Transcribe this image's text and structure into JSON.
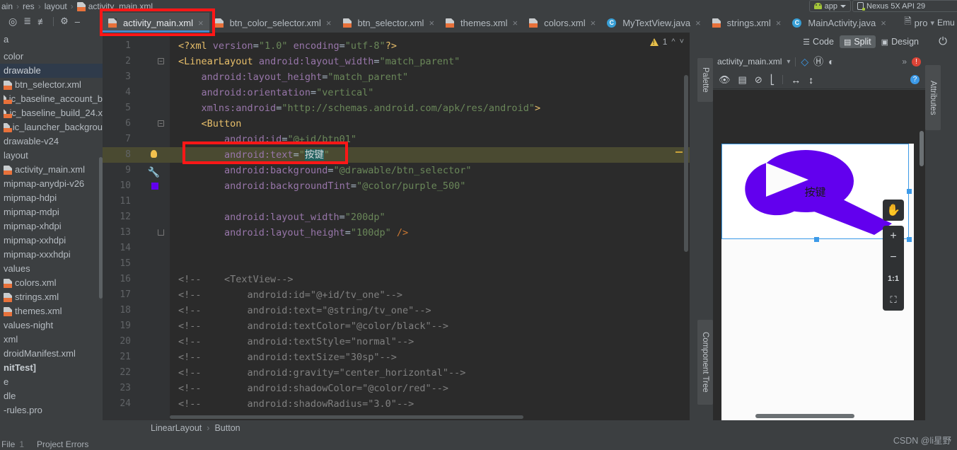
{
  "breadcrumb": {
    "items": [
      "ain",
      "res",
      "layout"
    ],
    "file": "activity_main.xml"
  },
  "run_config": {
    "app_label": "app",
    "device_label": "Nexus 5X API 29",
    "emulator_label": "Emu"
  },
  "project_panel": {
    "toolbar_icons": [
      "locate-icon",
      "expand-all-icon",
      "collapse-all-icon",
      "settings-icon",
      "hide-icon"
    ],
    "partial_top_label": "a",
    "items": [
      {
        "label": "color",
        "type": "folder",
        "selected": false
      },
      {
        "label": "drawable",
        "type": "folder",
        "selected": true
      },
      {
        "label": "btn_selector.xml",
        "type": "xml",
        "selected": false
      },
      {
        "label": "ic_baseline_account_b",
        "type": "xml",
        "selected": false
      },
      {
        "label": "ic_baseline_build_24.x",
        "type": "xml",
        "selected": false
      },
      {
        "label": "ic_launcher_backgrou",
        "type": "xml",
        "selected": false
      },
      {
        "label": "drawable-v24",
        "type": "folder",
        "selected": false
      },
      {
        "label": "layout",
        "type": "folder",
        "selected": false
      },
      {
        "label": "activity_main.xml",
        "type": "xml",
        "selected": false
      },
      {
        "label": "mipmap-anydpi-v26",
        "type": "folder",
        "selected": false
      },
      {
        "label": "mipmap-hdpi",
        "type": "folder",
        "selected": false
      },
      {
        "label": "mipmap-mdpi",
        "type": "folder",
        "selected": false
      },
      {
        "label": "mipmap-xhdpi",
        "type": "folder",
        "selected": false
      },
      {
        "label": "mipmap-xxhdpi",
        "type": "folder",
        "selected": false
      },
      {
        "label": "mipmap-xxxhdpi",
        "type": "folder",
        "selected": false
      },
      {
        "label": "values",
        "type": "folder",
        "selected": false
      },
      {
        "label": "colors.xml",
        "type": "xml",
        "selected": false
      },
      {
        "label": "strings.xml",
        "type": "xml",
        "selected": false
      },
      {
        "label": "themes.xml",
        "type": "xml",
        "selected": false
      },
      {
        "label": "values-night",
        "type": "folder",
        "selected": false
      },
      {
        "label": "xml",
        "type": "folder",
        "selected": false
      },
      {
        "label": "droidManifest.xml",
        "type": "folder",
        "selected": false
      },
      {
        "label": "nitTest]",
        "type": "bold",
        "selected": false
      },
      {
        "label": "e",
        "type": "folder",
        "selected": false
      },
      {
        "label": "dle",
        "type": "folder",
        "selected": false
      },
      {
        "label": "-rules.pro",
        "type": "folder",
        "selected": false
      }
    ]
  },
  "editor_tabs": [
    {
      "label": "activity_main.xml",
      "icon": "xml-file-icon",
      "active": true
    },
    {
      "label": "btn_color_selector.xml",
      "icon": "xml-file-icon",
      "active": false
    },
    {
      "label": "btn_selector.xml",
      "icon": "xml-file-icon",
      "active": false
    },
    {
      "label": "themes.xml",
      "icon": "xml-file-icon",
      "active": false
    },
    {
      "label": "colors.xml",
      "icon": "xml-file-icon",
      "active": false
    },
    {
      "label": "MyTextView.java",
      "icon": "java-class-icon",
      "active": false
    },
    {
      "label": "strings.xml",
      "icon": "xml-file-icon",
      "active": false
    },
    {
      "label": "MainActivity.java",
      "icon": "java-class-icon",
      "active": false
    },
    {
      "label": "pro",
      "icon": "props-file-icon",
      "active": false
    }
  ],
  "editor": {
    "warning_count": "1",
    "lines": [
      {
        "n": "1",
        "indent": 0,
        "segs": [
          {
            "t": "<?xml ",
            "c": "tag"
          },
          {
            "t": "version",
            "c": "ns"
          },
          {
            "t": "=",
            "c": "punct"
          },
          {
            "t": "\"1.0\"",
            "c": "val"
          },
          {
            "t": " ",
            "c": "punct"
          },
          {
            "t": "encoding",
            "c": "ns"
          },
          {
            "t": "=",
            "c": "punct"
          },
          {
            "t": "\"utf-8\"",
            "c": "val"
          },
          {
            "t": "?>",
            "c": "tag"
          }
        ]
      },
      {
        "n": "2",
        "fold": true,
        "segs": [
          {
            "t": "<LinearLayout",
            "c": "tag"
          },
          {
            "t": " ",
            "c": "punct"
          },
          {
            "t": "android:layout_width",
            "c": "ns"
          },
          {
            "t": "=",
            "c": "punct"
          },
          {
            "t": "\"match_parent\"",
            "c": "val"
          }
        ]
      },
      {
        "n": "3",
        "segs": [
          {
            "t": "    ",
            "c": "punct"
          },
          {
            "t": "android:layout_height",
            "c": "ns"
          },
          {
            "t": "=",
            "c": "punct"
          },
          {
            "t": "\"match_parent\"",
            "c": "val"
          }
        ]
      },
      {
        "n": "4",
        "segs": [
          {
            "t": "    ",
            "c": "punct"
          },
          {
            "t": "android:orientation",
            "c": "ns"
          },
          {
            "t": "=",
            "c": "punct"
          },
          {
            "t": "\"vertical\"",
            "c": "val"
          }
        ]
      },
      {
        "n": "5",
        "segs": [
          {
            "t": "    ",
            "c": "punct"
          },
          {
            "t": "xmlns:android",
            "c": "ns"
          },
          {
            "t": "=",
            "c": "punct"
          },
          {
            "t": "\"http://schemas.android.com/apk/res/android\"",
            "c": "val"
          },
          {
            "t": ">",
            "c": "tag"
          }
        ]
      },
      {
        "n": "6",
        "fold": true,
        "segs": [
          {
            "t": "    ",
            "c": "punct"
          },
          {
            "t": "<Button",
            "c": "tag"
          }
        ]
      },
      {
        "n": "7",
        "boxed": true,
        "segs": [
          {
            "t": "        ",
            "c": "punct"
          },
          {
            "t": "android:id",
            "c": "ns"
          },
          {
            "t": "=",
            "c": "punct"
          },
          {
            "t": "\"@+id/btn01\"",
            "c": "val"
          }
        ]
      },
      {
        "n": "8",
        "bulb": true,
        "highlight": true,
        "segs": [
          {
            "t": "        ",
            "c": "punct"
          },
          {
            "t": "android:text",
            "c": "ns"
          },
          {
            "t": "=",
            "c": "punct"
          },
          {
            "t": "\"",
            "c": "val"
          },
          {
            "t": "按键",
            "c": "sel"
          },
          {
            "t": "\"",
            "c": "val"
          }
        ]
      },
      {
        "n": "9",
        "wrench": true,
        "segs": [
          {
            "t": "        ",
            "c": "punct"
          },
          {
            "t": "android:background",
            "c": "ns"
          },
          {
            "t": "=",
            "c": "punct"
          },
          {
            "t": "\"@drawable/btn_selector\"",
            "c": "val"
          }
        ]
      },
      {
        "n": "10",
        "swatch": true,
        "segs": [
          {
            "t": "        ",
            "c": "punct"
          },
          {
            "t": "android:backgroundTint",
            "c": "ns"
          },
          {
            "t": "=",
            "c": "punct"
          },
          {
            "t": "\"@color/purple_500\"",
            "c": "val"
          }
        ]
      },
      {
        "n": "11",
        "segs": []
      },
      {
        "n": "12",
        "segs": [
          {
            "t": "        ",
            "c": "punct"
          },
          {
            "t": "android:layout_width",
            "c": "ns"
          },
          {
            "t": "=",
            "c": "punct"
          },
          {
            "t": "\"200dp\"",
            "c": "val"
          }
        ]
      },
      {
        "n": "13",
        "foldend": true,
        "segs": [
          {
            "t": "        ",
            "c": "punct"
          },
          {
            "t": "android:layout_height",
            "c": "ns"
          },
          {
            "t": "=",
            "c": "punct"
          },
          {
            "t": "\"100dp\" ",
            "c": "val"
          },
          {
            "t": "/>",
            "c": "brk"
          }
        ]
      },
      {
        "n": "14",
        "segs": []
      },
      {
        "n": "15",
        "segs": []
      },
      {
        "n": "16",
        "segs": [
          {
            "t": "<!--    <TextView-->",
            "c": "cmt"
          }
        ]
      },
      {
        "n": "17",
        "segs": [
          {
            "t": "<!--        android:id=\"@+id/tv_one\"-->",
            "c": "cmt"
          }
        ]
      },
      {
        "n": "18",
        "segs": [
          {
            "t": "<!--        android:text=\"@string/tv_one\"-->",
            "c": "cmt"
          }
        ]
      },
      {
        "n": "19",
        "segs": [
          {
            "t": "<!--        android:textColor=\"@color/black\"-->",
            "c": "cmt"
          }
        ]
      },
      {
        "n": "20",
        "segs": [
          {
            "t": "<!--        android:textStyle=\"normal\"-->",
            "c": "cmt"
          }
        ]
      },
      {
        "n": "21",
        "segs": [
          {
            "t": "<!--        android:textSize=\"30sp\"-->",
            "c": "cmt"
          }
        ]
      },
      {
        "n": "22",
        "segs": [
          {
            "t": "<!--        android:gravity=\"center_horizontal\"-->",
            "c": "cmt"
          }
        ]
      },
      {
        "n": "23",
        "segs": [
          {
            "t": "<!--        android:shadowColor=\"@color/red\"-->",
            "c": "cmt"
          }
        ]
      },
      {
        "n": "24",
        "segs": [
          {
            "t": "<!--        android:shadowRadius=\"3.0\"-->",
            "c": "cmt"
          }
        ]
      }
    ],
    "bottom_breadcrumb": [
      "LinearLayout",
      "Button"
    ]
  },
  "view_mode": {
    "options": [
      "Code",
      "Split",
      "Design"
    ],
    "selected": "Split"
  },
  "tool_tabs": {
    "palette": "Palette",
    "component_tree": "Component Tree",
    "attributes": "Attributes"
  },
  "design_preview": {
    "file_selector": "activity_main.xml",
    "toolbar_row1_icons": [
      "layers-icon",
      "blueprint-icon",
      "theme-icon",
      "overflow-icon",
      "error-icon"
    ],
    "toolbar_row2_icons": [
      "eye-icon",
      "columns-icon",
      "constraints-off-icon",
      "margins-icon",
      "horizontal-align-icon",
      "vertical-align-icon",
      "help-icon"
    ],
    "button_text": "按键",
    "button_color": "#6200ee",
    "zoom_controls": [
      "pan-hand-icon",
      "+",
      "−",
      "1:1",
      "fit-screen-icon"
    ]
  },
  "status_bar": {
    "file_label": "File",
    "file_count": "1",
    "errors_label": "Project Errors"
  },
  "watermark": "CSDN @li星野"
}
